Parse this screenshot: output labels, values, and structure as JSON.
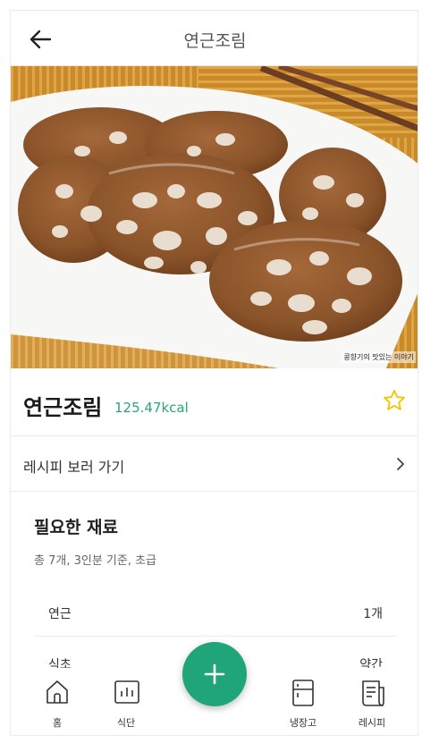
{
  "header": {
    "title": "연근조림"
  },
  "hero": {
    "watermark": "콩향기의 맛있는 이야기"
  },
  "dish": {
    "name": "연근조림",
    "kcal": "125.47kcal",
    "favorite": false
  },
  "recipe_link": {
    "label": "레시피 보러 가기"
  },
  "ingredients": {
    "title": "필요한 재료",
    "summary": "총 7개, 3인분 기준, 초급",
    "items": [
      {
        "name": "연근",
        "qty": "1개"
      },
      {
        "name": "식초",
        "qty": "약간"
      }
    ]
  },
  "nav": {
    "items": [
      {
        "label": "홈",
        "icon": "home-icon"
      },
      {
        "label": "식단",
        "icon": "chart-icon"
      },
      {
        "label": "냉장고",
        "icon": "fridge-icon"
      },
      {
        "label": "레시피",
        "icon": "recipe-icon"
      }
    ],
    "fab_icon": "plus-icon"
  },
  "colors": {
    "accent": "#1fa579",
    "kcal": "#2aa57a",
    "star": "#f5c400"
  }
}
